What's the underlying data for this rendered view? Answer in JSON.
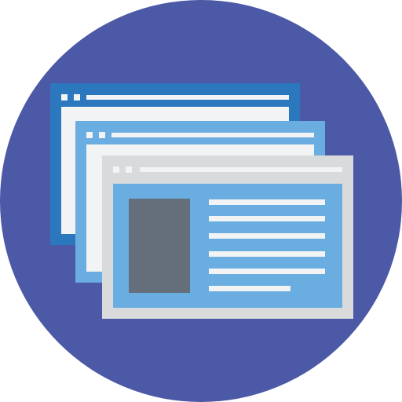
{
  "icon": {
    "name": "browser-windows-icon",
    "colors": {
      "circle": "#4b59a6",
      "back_frame": "#2b78bf",
      "middle_frame": "#6aaee1",
      "front_frame": "#d9dadb",
      "panel": "#f2f3f4",
      "content_blue": "#6aaee1",
      "image_block": "#656f7b",
      "text_lines": "#f2f3f4",
      "bar_white": "#f2f3f4"
    }
  }
}
